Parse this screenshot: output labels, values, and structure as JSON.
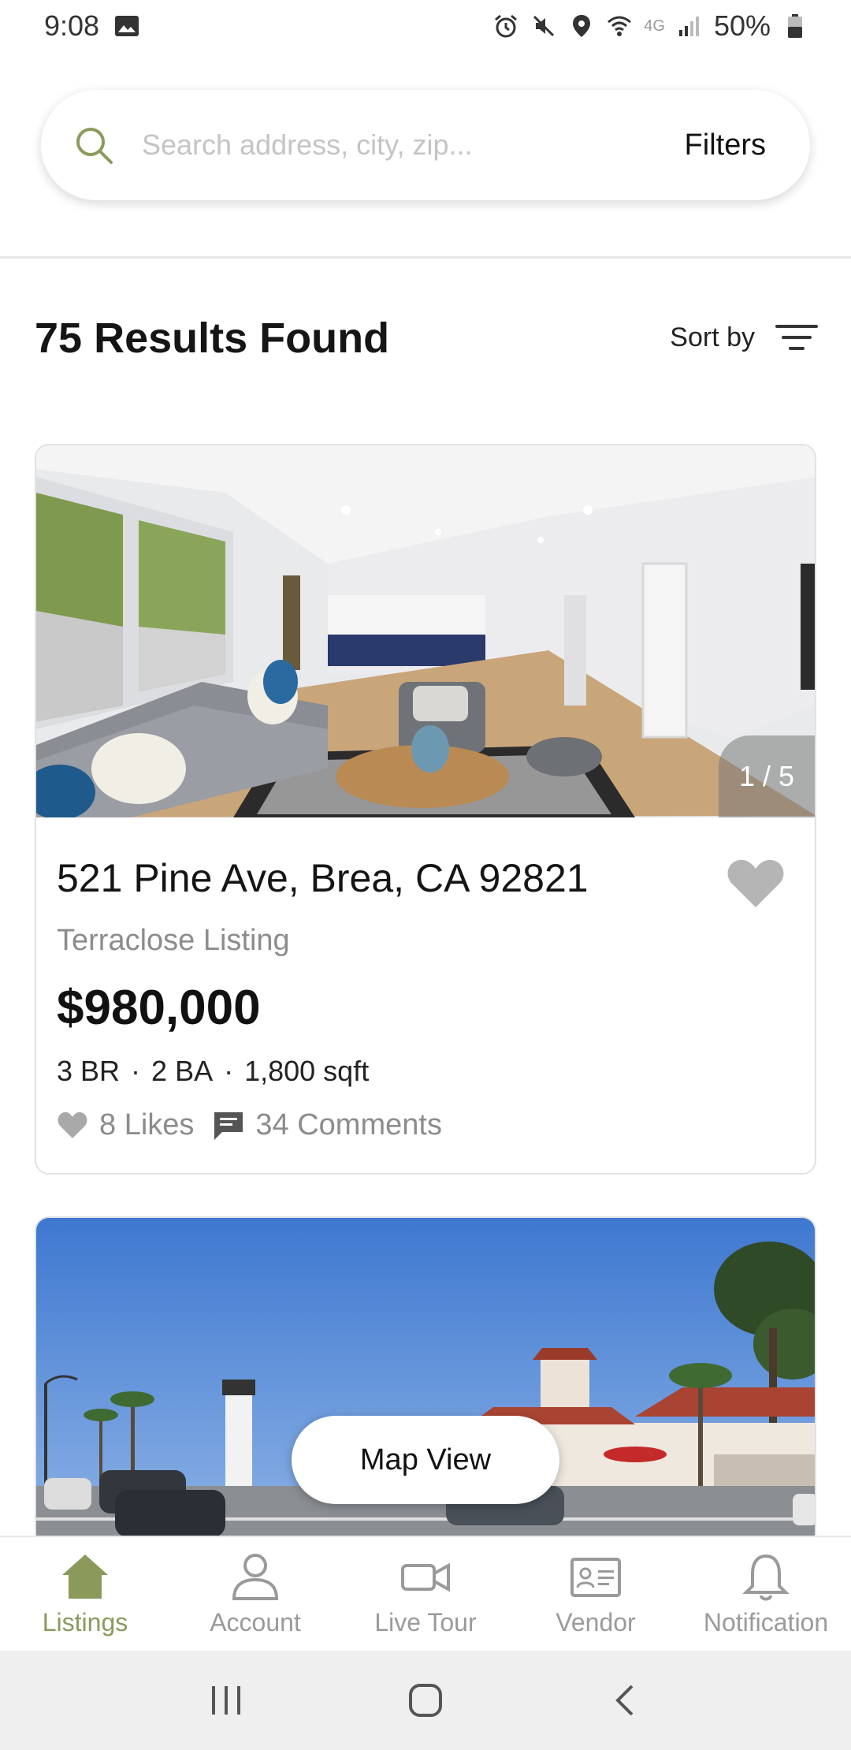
{
  "status_bar": {
    "time": "9:08",
    "network": "4G",
    "battery": "50%",
    "icons": [
      "image-icon",
      "alarm-icon",
      "mute-icon",
      "location-icon",
      "wifi-icon",
      "signal-icon",
      "battery-icon"
    ]
  },
  "search": {
    "placeholder": "Search address, city, zip...",
    "value": "",
    "filters_label": "Filters"
  },
  "results": {
    "title": "75 Results Found",
    "sort_label": "Sort by"
  },
  "listings": [
    {
      "address": "521 Pine Ave, Brea, CA 92821",
      "source": "Terraclose Listing",
      "price": "$980,000",
      "beds": "3 BR",
      "baths": "2 BA",
      "area": "1,800 sqft",
      "likes": "8 Likes",
      "comments": "34 Comments",
      "image_counter": "1 / 5",
      "favorited": false
    },
    {
      "image": "street-scene"
    }
  ],
  "map_view_label": "Map View",
  "bottom_nav": {
    "active": "Listings",
    "items": [
      {
        "label": "Listings",
        "icon": "home-icon"
      },
      {
        "label": "Account",
        "icon": "user-icon"
      },
      {
        "label": "Live Tour",
        "icon": "video-icon"
      },
      {
        "label": "Vendor",
        "icon": "id-card-icon"
      },
      {
        "label": "Notification",
        "icon": "bell-icon"
      }
    ]
  },
  "colors": {
    "accent": "#8a9a5b",
    "muted": "#8c8c8c"
  }
}
